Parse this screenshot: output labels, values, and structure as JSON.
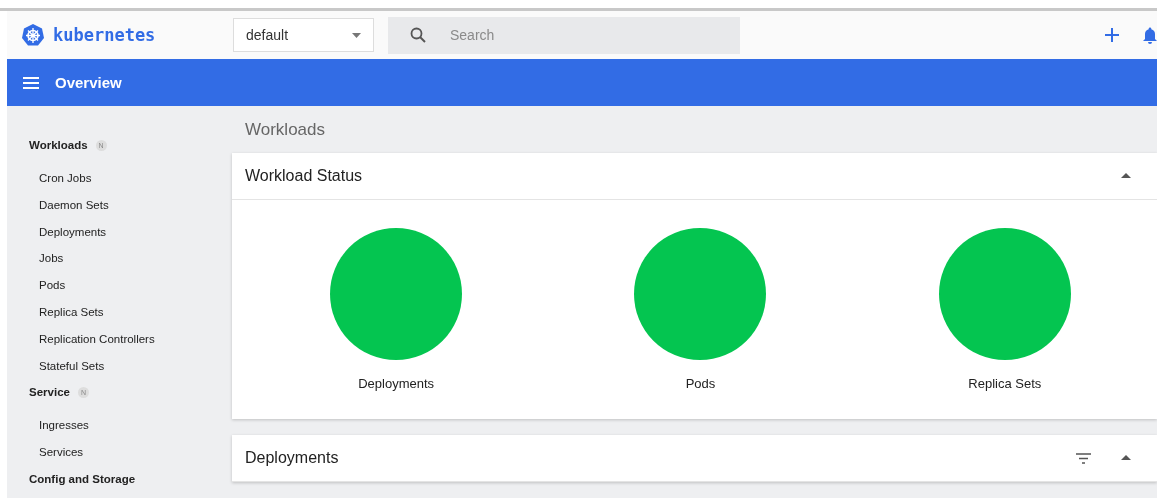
{
  "header": {
    "brand": "kubernetes",
    "namespace": "default",
    "search": {
      "placeholder": "Search"
    }
  },
  "title_bar": {
    "title": "Overview"
  },
  "sidebar": {
    "sections": [
      {
        "title": "Workloads",
        "badge": "N",
        "items": [
          "Cron Jobs",
          "Daemon Sets",
          "Deployments",
          "Jobs",
          "Pods",
          "Replica Sets",
          "Replication Controllers",
          "Stateful Sets"
        ]
      },
      {
        "title": "Service",
        "badge": "N",
        "items": [
          "Ingresses",
          "Services"
        ]
      },
      {
        "title": "Config and Storage"
      }
    ]
  },
  "main": {
    "heading": "Workloads",
    "status_card": {
      "title": "Workload Status",
      "expanded": true,
      "items": [
        {
          "label": "Deployments",
          "color": "#04c550"
        },
        {
          "label": "Pods",
          "color": "#04c550"
        },
        {
          "label": "Replica Sets",
          "color": "#04c550"
        }
      ]
    },
    "deployments_card": {
      "title": "Deployments",
      "expanded": true
    }
  }
}
